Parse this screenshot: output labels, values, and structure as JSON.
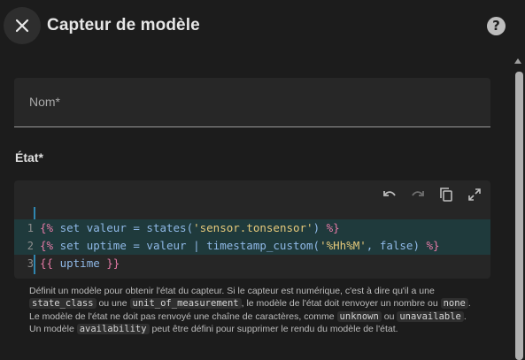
{
  "dialog": {
    "title": "Capteur de modèle",
    "close_icon": "close-icon",
    "help_icon": "help-icon"
  },
  "name_field": {
    "label": "Nom*"
  },
  "state": {
    "label": "État*",
    "toolbar": [
      "undo-icon",
      "redo-icon",
      "copy-icon",
      "fullscreen-icon"
    ],
    "lines": [
      {
        "num": "1",
        "text": "{% set valeur = states('sensor.tonsensor') %}"
      },
      {
        "num": "2",
        "text": "{% set uptime = valeur | timestamp_custom('%Hh%M', false) %}"
      },
      {
        "num": "3",
        "text": "{{ uptime }}"
      }
    ]
  },
  "helper": {
    "p1": "Définit un modèle pour obtenir l'état du capteur. Si le capteur est numérique, c'est à dire qu'il a une ",
    "c1": "state_class",
    "p2": " ou une ",
    "c2": "unit_of_measurement",
    "p3": ", le modèle de l'état doit renvoyer un nombre ou ",
    "c3": "none",
    "p4": ". Le modèle de l'état ne doit pas renvoyé une chaîne de caractères, comme ",
    "c4": "unknown",
    "p5": " ou ",
    "c5": "unavailable",
    "p6": ". Un modèle ",
    "c6": "availability",
    "p7": " peut être défini pour supprimer le rendu du modèle de l'état."
  },
  "colors": {
    "background": "#1c1c1c",
    "active_line": "#1f3a3c",
    "accent": "#2f86b0"
  }
}
